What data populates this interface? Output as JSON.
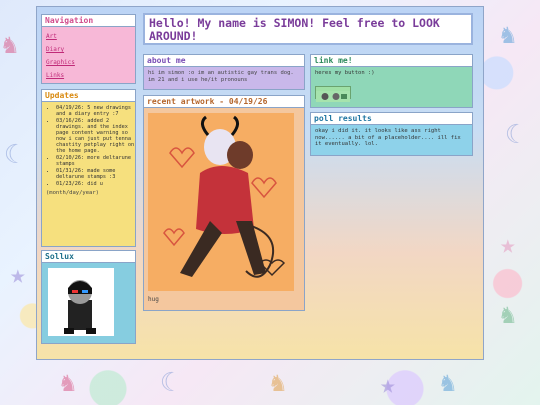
{
  "title": "Hello! My name is SIMON! Feel free to LOOK AROUND!",
  "navigation": {
    "header": "Navigation",
    "links": [
      "Art",
      "Diary",
      "Graphics",
      "Links"
    ]
  },
  "updates": {
    "header": "Updates",
    "items": [
      "04/19/26: 5 new drawings and a diary entry :7",
      "03/16/26: added 2 drawings. and the index page content warning so now i can just put tenna chastity petplay right on the home page.",
      "02/10/26: more deltarune stamps",
      "01/31/26: made some deltarune stamps :3",
      "01/23/26: did u"
    ],
    "date_format": "(month/day/year)"
  },
  "sollux": {
    "header": "Sollux"
  },
  "about": {
    "header": "about me",
    "text": "hi im simon :o im an autistic gay trans dog. im 21 and i use he/it pronouns"
  },
  "artwork": {
    "header": "recent artwork - 04/19/26",
    "caption": "hug"
  },
  "link_me": {
    "header": "link me!",
    "text": "heres my button :)"
  },
  "poll": {
    "header": "poll results",
    "text": "okay i did it. it looks like ass right now...... a bit of a placeholder.... ill fix it eventually. lol."
  },
  "colors": {
    "title_text": "#7a3c9a",
    "nav_bg": "#f7b8d7",
    "updates_bg": "#f6e07e",
    "sollux_bg": "#86cde0",
    "about_bg": "#c9b8ea",
    "art_bg": "#f4c79e",
    "link_bg": "#8fd7b8",
    "poll_bg": "#8ed2ea"
  }
}
